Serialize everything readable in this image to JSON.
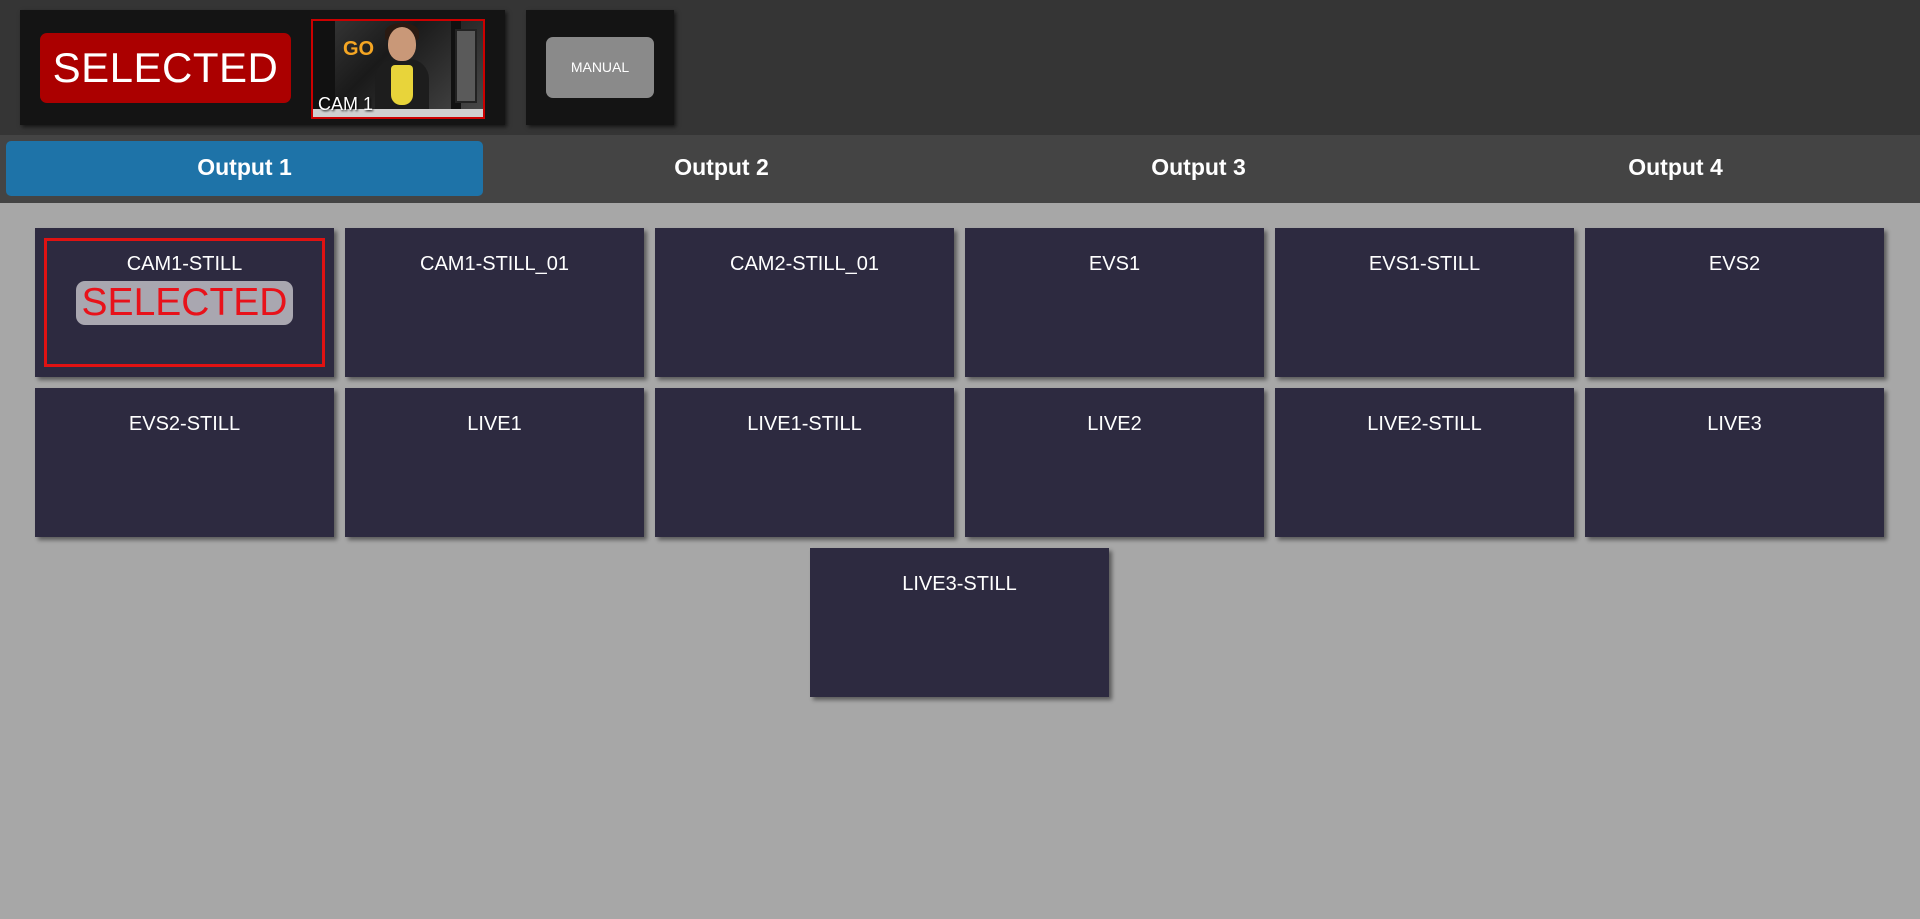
{
  "status": {
    "selected_label": "SELECTED",
    "preview_label": "CAM 1",
    "preview_logo_text": "GO"
  },
  "manual": {
    "label": "MANUAL"
  },
  "tabs": [
    {
      "label": "Output 1",
      "active": true
    },
    {
      "label": "Output 2",
      "active": false
    },
    {
      "label": "Output 3",
      "active": false
    },
    {
      "label": "Output 4",
      "active": false
    }
  ],
  "sources": [
    {
      "label": "CAM1-STILL",
      "selected": true,
      "badge": "SELECTED"
    },
    {
      "label": "CAM1-STILL_01"
    },
    {
      "label": "CAM2-STILL_01"
    },
    {
      "label": "EVS1"
    },
    {
      "label": "EVS1-STILL"
    },
    {
      "label": "EVS2"
    },
    {
      "label": "EVS2-STILL"
    },
    {
      "label": "LIVE1"
    },
    {
      "label": "LIVE1-STILL"
    },
    {
      "label": "LIVE2"
    },
    {
      "label": "LIVE2-STILL"
    },
    {
      "label": "LIVE3"
    },
    {
      "label": "LIVE3-STILL"
    }
  ],
  "colors": {
    "accent_tab": "#1e73a8",
    "selected_red": "#ab0000",
    "tile_bg": "#2d2a40",
    "page_bg": "#a7a7a7"
  }
}
